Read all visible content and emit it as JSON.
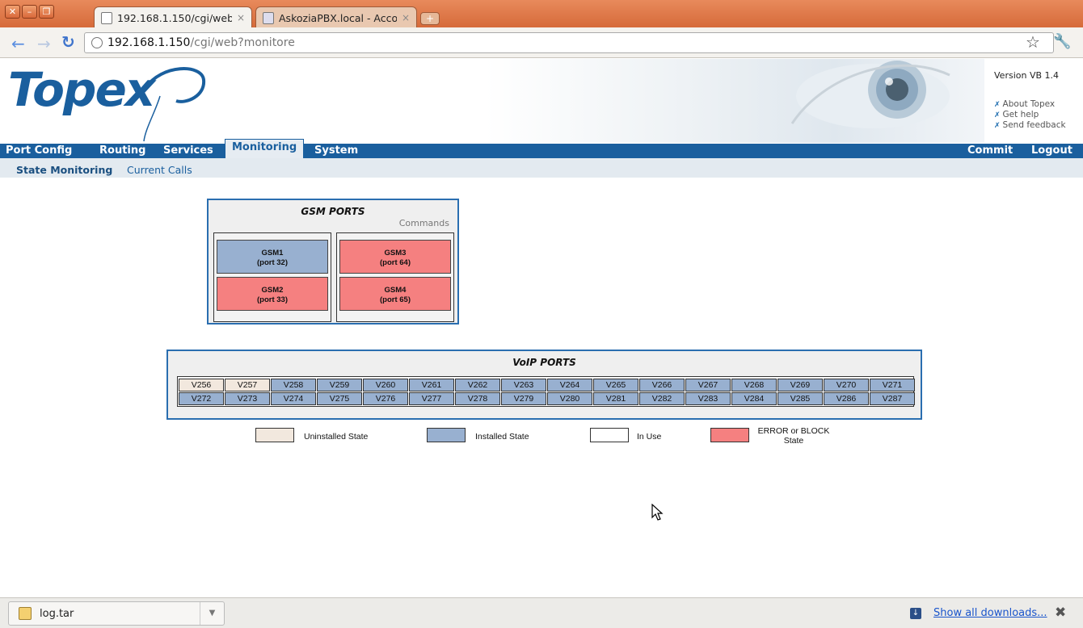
{
  "browser": {
    "tabs": [
      {
        "title": "192.168.1.150/cgi/web...",
        "close": "×"
      },
      {
        "title": "AskoziaPBX.local - Acco...",
        "close": "×"
      }
    ],
    "new_tab": "+",
    "window_buttons": [
      "✕",
      "–",
      "❐"
    ],
    "url_host": "192.168.1.150",
    "url_path": "/cgi/web?monitore",
    "icons": {
      "back": "back-arrow-icon",
      "forward": "forward-arrow-icon",
      "reload": "reload-icon",
      "bookmark": "star-icon",
      "settings": "wrench-icon"
    }
  },
  "header": {
    "logo": "Topex",
    "version": "Version VB 1.4",
    "links": [
      "About Topex",
      "Get help",
      "Send feedback"
    ]
  },
  "nav": {
    "main": [
      "Port Config",
      "Routing",
      "Services",
      "Monitoring",
      "System"
    ],
    "active": "Monitoring",
    "right": [
      "Commit",
      "Logout"
    ],
    "sub": [
      "State Monitoring",
      "Current Calls"
    ],
    "sub_active": "State Monitoring"
  },
  "gsm": {
    "title": "GSM PORTS",
    "commands": "Commands",
    "ports": [
      {
        "name": "GSM1",
        "port": "(port 32)",
        "state": "installed"
      },
      {
        "name": "GSM2",
        "port": "(port 33)",
        "state": "error"
      },
      {
        "name": "GSM3",
        "port": "(port 64)",
        "state": "error"
      },
      {
        "name": "GSM4",
        "port": "(port 65)",
        "state": "error"
      }
    ]
  },
  "voip": {
    "title": "VoIP PORTS",
    "row1": [
      "V256",
      "V257",
      "V258",
      "V259",
      "V260",
      "V261",
      "V262",
      "V263",
      "V264",
      "V265",
      "V266",
      "V267",
      "V268",
      "V269",
      "V270",
      "V271"
    ],
    "row2": [
      "V272",
      "V273",
      "V274",
      "V275",
      "V276",
      "V277",
      "V278",
      "V279",
      "V280",
      "V281",
      "V282",
      "V283",
      "V284",
      "V285",
      "V286",
      "V287"
    ],
    "uninstalled": [
      "V256",
      "V257"
    ]
  },
  "legend": [
    {
      "label": "Uninstalled State",
      "color": "#f2e8de"
    },
    {
      "label": "Installed State",
      "color": "#98b0d0"
    },
    {
      "label": "In Use",
      "color": "#ffffff"
    },
    {
      "label": "ERROR or BLOCK State",
      "label_line1": "ERROR or BLOCK",
      "label_line2": "State",
      "color": "#f58080"
    }
  ],
  "downloads": {
    "file": "log.tar",
    "show_all": "Show all downloads...",
    "close": "✖"
  }
}
